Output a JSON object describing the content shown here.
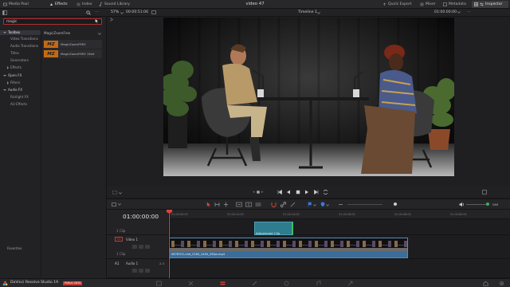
{
  "topbar": {
    "media_pool": "Media Pool",
    "effects": "Effects",
    "index": "Index",
    "sound_library": "Sound Library",
    "window_title": "video 47",
    "quick_export": "Quick Export",
    "mixer": "Mixer",
    "metadata": "Metadata",
    "inspector": "Inspector"
  },
  "subbar": {
    "zoom": "57%",
    "source_timecode": "00:00:51:06",
    "timeline_name": "Timeline 1",
    "record_timecode": "01:00:00:00"
  },
  "effects_panel": {
    "search_value": "magic",
    "toolbox": "Toolbox",
    "video_transitions": "Video Transitions",
    "audio_transitions": "Audio Transitions",
    "titles": "Titles",
    "generators": "Generators",
    "effects": "Effects",
    "open_fx": "Open FX",
    "filters": "Filters",
    "audio_fx": "Audio FX",
    "fairlight_fx": "Fairlight FX",
    "all_effects": "AU Effects",
    "favorites": "Favorites",
    "results_group": "MagicZoomFree",
    "result_1": "MagicZoomFREE",
    "result_2": "MagicZoomFREE 16x9",
    "thumb_text": "MZ"
  },
  "timeline": {
    "timecode": "01:00:00:00",
    "ticks": [
      "01:00:00:00",
      "01:00:12:00",
      "01:00:24:00",
      "01:00:36:00",
      "01:00:48:00",
      "01:00:60:00"
    ],
    "v2_clip_count": "1 Clip",
    "v1_badge": "V1",
    "v1_name": "Video 1",
    "v1_clip_count": "1 Clip",
    "a1_badge": "A1",
    "a1_name": "Audio 1",
    "a1_level": "2.0",
    "adjustment_clip": "Adjustment Clip",
    "video_clip": "0878701-uhd_2160_1440_25fps.mp4"
  },
  "bottombar": {
    "app_name": "DaVinci Resolve Studio 19",
    "badge": "PUBLIC BETA"
  },
  "colors": {
    "accent_red": "#e0403a",
    "clip_blue": "#3c6d9a",
    "adjustment_teal": "#2f7c8e",
    "thumb_orange": "#c46a14"
  }
}
